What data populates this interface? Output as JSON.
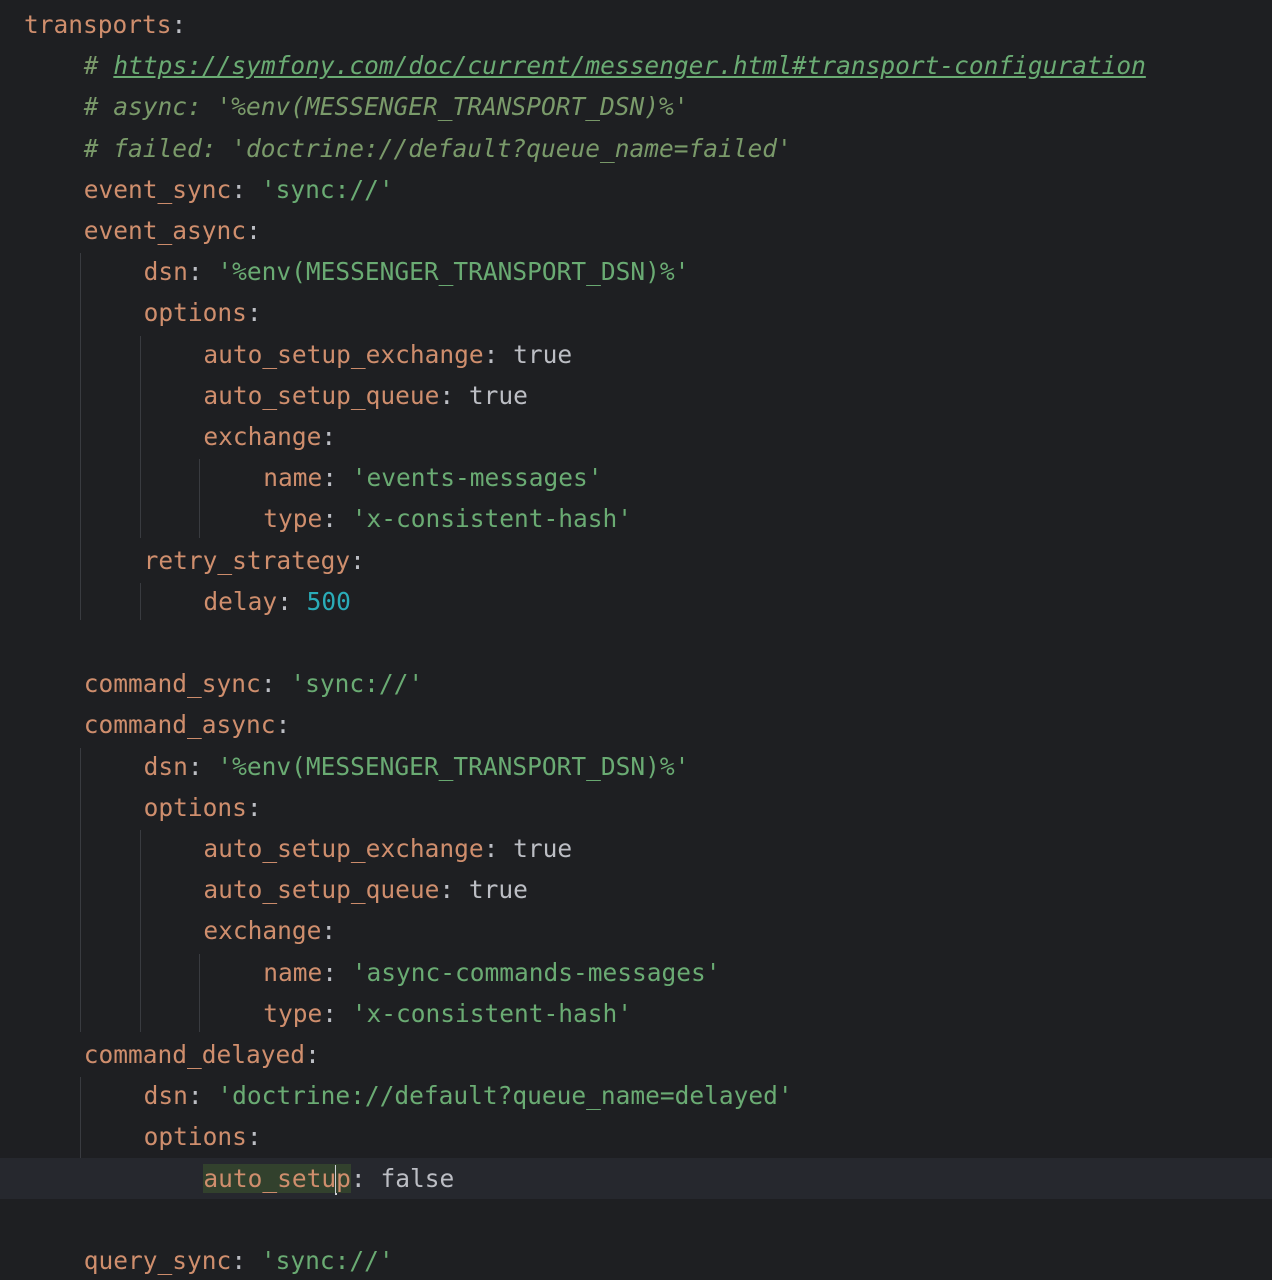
{
  "editor": {
    "lines": [
      {
        "indent": 0,
        "parts": [
          {
            "k": "key",
            "t": "transports"
          },
          {
            "k": "punc",
            "t": ":"
          }
        ]
      },
      {
        "indent": 1,
        "parts": [
          {
            "k": "comment",
            "t": "# "
          },
          {
            "k": "link",
            "t": "https://symfony.com/doc/current/messenger.html#transport-configuration"
          }
        ]
      },
      {
        "indent": 1,
        "parts": [
          {
            "k": "comment",
            "t": "# async: '%env(MESSENGER_TRANSPORT_DSN)%'"
          }
        ]
      },
      {
        "indent": 1,
        "parts": [
          {
            "k": "comment",
            "t": "# failed: 'doctrine://default?queue_name=failed'"
          }
        ]
      },
      {
        "indent": 1,
        "parts": [
          {
            "k": "key",
            "t": "event_sync"
          },
          {
            "k": "punc",
            "t": ": "
          },
          {
            "k": "str",
            "t": "'sync://'"
          }
        ]
      },
      {
        "indent": 1,
        "parts": [
          {
            "k": "key",
            "t": "event_async"
          },
          {
            "k": "punc",
            "t": ":"
          }
        ]
      },
      {
        "indent": 2,
        "parts": [
          {
            "k": "key",
            "t": "dsn"
          },
          {
            "k": "punc",
            "t": ": "
          },
          {
            "k": "str",
            "t": "'%env(MESSENGER_TRANSPORT_DSN)%'"
          }
        ]
      },
      {
        "indent": 2,
        "parts": [
          {
            "k": "key",
            "t": "options"
          },
          {
            "k": "punc",
            "t": ":"
          }
        ]
      },
      {
        "indent": 3,
        "parts": [
          {
            "k": "key",
            "t": "auto_setup_exchange"
          },
          {
            "k": "punc",
            "t": ": "
          },
          {
            "k": "bool",
            "t": "true"
          }
        ]
      },
      {
        "indent": 3,
        "parts": [
          {
            "k": "key",
            "t": "auto_setup_queue"
          },
          {
            "k": "punc",
            "t": ": "
          },
          {
            "k": "bool",
            "t": "true"
          }
        ]
      },
      {
        "indent": 3,
        "parts": [
          {
            "k": "key",
            "t": "exchange"
          },
          {
            "k": "punc",
            "t": ":"
          }
        ]
      },
      {
        "indent": 4,
        "parts": [
          {
            "k": "key",
            "t": "name"
          },
          {
            "k": "punc",
            "t": ": "
          },
          {
            "k": "str",
            "t": "'events-messages'"
          }
        ]
      },
      {
        "indent": 4,
        "parts": [
          {
            "k": "key",
            "t": "type"
          },
          {
            "k": "punc",
            "t": ": "
          },
          {
            "k": "str",
            "t": "'x-consistent-hash'"
          }
        ]
      },
      {
        "indent": 2,
        "parts": [
          {
            "k": "key",
            "t": "retry_strategy"
          },
          {
            "k": "punc",
            "t": ":"
          }
        ]
      },
      {
        "indent": 3,
        "parts": [
          {
            "k": "key",
            "t": "delay"
          },
          {
            "k": "punc",
            "t": ": "
          },
          {
            "k": "num",
            "t": "500"
          }
        ]
      },
      {
        "indent": 0,
        "parts": []
      },
      {
        "indent": 1,
        "parts": [
          {
            "k": "key",
            "t": "command_sync"
          },
          {
            "k": "punc",
            "t": ": "
          },
          {
            "k": "str",
            "t": "'sync://'"
          }
        ]
      },
      {
        "indent": 1,
        "parts": [
          {
            "k": "key",
            "t": "command_async"
          },
          {
            "k": "punc",
            "t": ":"
          }
        ]
      },
      {
        "indent": 2,
        "parts": [
          {
            "k": "key",
            "t": "dsn"
          },
          {
            "k": "punc",
            "t": ": "
          },
          {
            "k": "str",
            "t": "'%env(MESSENGER_TRANSPORT_DSN)%'"
          }
        ]
      },
      {
        "indent": 2,
        "parts": [
          {
            "k": "key",
            "t": "options"
          },
          {
            "k": "punc",
            "t": ":"
          }
        ]
      },
      {
        "indent": 3,
        "parts": [
          {
            "k": "key",
            "t": "auto_setup_exchange"
          },
          {
            "k": "punc",
            "t": ": "
          },
          {
            "k": "bool",
            "t": "true"
          }
        ]
      },
      {
        "indent": 3,
        "parts": [
          {
            "k": "key",
            "t": "auto_setup_queue"
          },
          {
            "k": "punc",
            "t": ": "
          },
          {
            "k": "bool",
            "t": "true"
          }
        ]
      },
      {
        "indent": 3,
        "parts": [
          {
            "k": "key",
            "t": "exchange"
          },
          {
            "k": "punc",
            "t": ":"
          }
        ]
      },
      {
        "indent": 4,
        "parts": [
          {
            "k": "key",
            "t": "name"
          },
          {
            "k": "punc",
            "t": ": "
          },
          {
            "k": "str",
            "t": "'async-commands-messages'"
          }
        ]
      },
      {
        "indent": 4,
        "parts": [
          {
            "k": "key",
            "t": "type"
          },
          {
            "k": "punc",
            "t": ": "
          },
          {
            "k": "str",
            "t": "'x-consistent-hash'"
          }
        ]
      },
      {
        "indent": 1,
        "parts": [
          {
            "k": "key",
            "t": "command_delayed"
          },
          {
            "k": "punc",
            "t": ":"
          }
        ]
      },
      {
        "indent": 2,
        "parts": [
          {
            "k": "key",
            "t": "dsn"
          },
          {
            "k": "punc",
            "t": ": "
          },
          {
            "k": "str",
            "t": "'doctrine://default?queue_name=delayed'"
          }
        ]
      },
      {
        "indent": 2,
        "parts": [
          {
            "k": "key",
            "t": "options"
          },
          {
            "k": "punc",
            "t": ":"
          }
        ]
      },
      {
        "indent": 3,
        "current": true,
        "parts": [
          {
            "k": "key hl",
            "t": "auto_setu"
          },
          {
            "k": "caret",
            "t": ""
          },
          {
            "k": "key hl",
            "t": "p"
          },
          {
            "k": "punc",
            "t": ": "
          },
          {
            "k": "bool",
            "t": "false"
          }
        ]
      },
      {
        "indent": 0,
        "parts": []
      },
      {
        "indent": 1,
        "parts": [
          {
            "k": "key",
            "t": "query_sync"
          },
          {
            "k": "punc",
            "t": ": "
          },
          {
            "k": "str",
            "t": "'sync://'"
          }
        ]
      }
    ]
  }
}
